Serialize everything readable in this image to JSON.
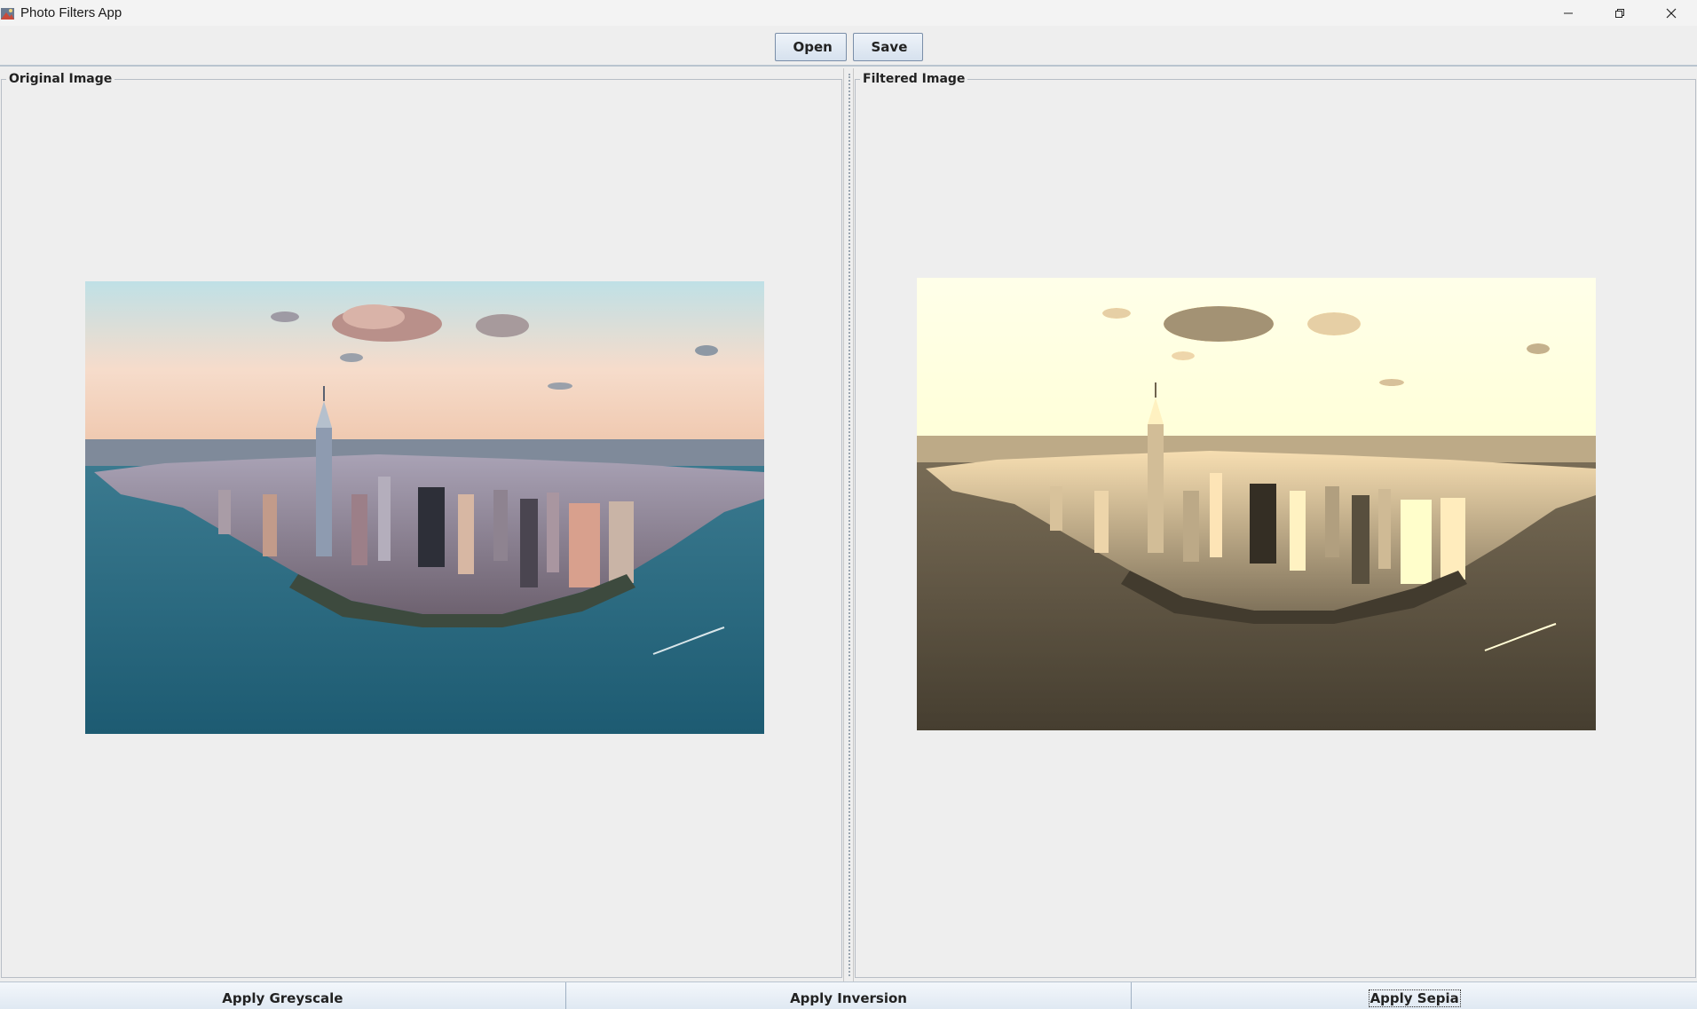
{
  "window": {
    "title": "Photo Filters App"
  },
  "toolbar": {
    "open_label": "Open",
    "save_label": "Save"
  },
  "panels": {
    "original_title": "Original Image",
    "filtered_title": "Filtered Image"
  },
  "filters": {
    "greyscale_label": "Apply Greyscale",
    "inversion_label": "Apply Inversion",
    "sepia_label": "Apply Sepia"
  },
  "colors": {
    "window_bg": "#eeeeee",
    "button_border": "#7a8ea8",
    "sky_top": "#bfe0e6",
    "sky_bottom": "#f4d9c8",
    "water": "#2f6f86"
  },
  "icons": {
    "app": "photo-app-icon",
    "minimize": "minimize-icon",
    "maximize": "restore-icon",
    "close": "close-icon"
  }
}
